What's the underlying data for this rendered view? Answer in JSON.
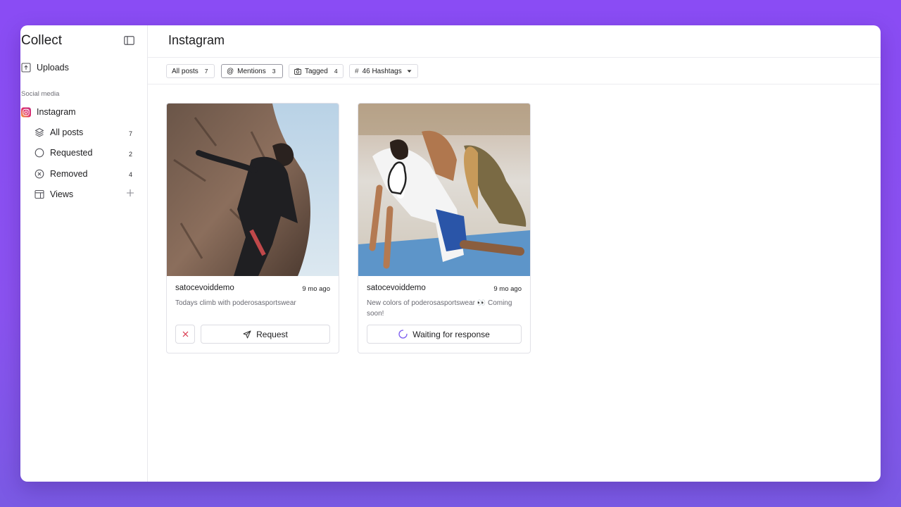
{
  "sidebar": {
    "app_title": "Collect",
    "uploads_label": "Uploads",
    "section_label": "Social media",
    "instagram_label": "Instagram",
    "items": [
      {
        "label": "All posts",
        "count": "7"
      },
      {
        "label": "Requested",
        "count": "2"
      },
      {
        "label": "Removed",
        "count": "4"
      },
      {
        "label": "Views"
      }
    ]
  },
  "main": {
    "title": "Instagram",
    "filters": [
      {
        "label": "All posts",
        "count": "7"
      },
      {
        "label": "Mentions",
        "count": "3"
      },
      {
        "label": "Tagged",
        "count": "4"
      },
      {
        "label": "46 Hashtags"
      }
    ],
    "active_filter": "Mentions",
    "cards": [
      {
        "username": "satocevoiddemo",
        "time": "9 mo ago",
        "caption": "Todays climb with poderosasportswear",
        "action_label": "Request"
      },
      {
        "username": "satocevoiddemo",
        "time": "9 mo ago",
        "caption": "New colors of poderosasportswear 👀 Coming soon!",
        "action_label": "Waiting for response"
      }
    ]
  },
  "colors": {
    "background": "#8a4cf4",
    "instagram": "#e1306c",
    "spinner": "#7c5cf0",
    "remove_x": "#d9334a"
  }
}
